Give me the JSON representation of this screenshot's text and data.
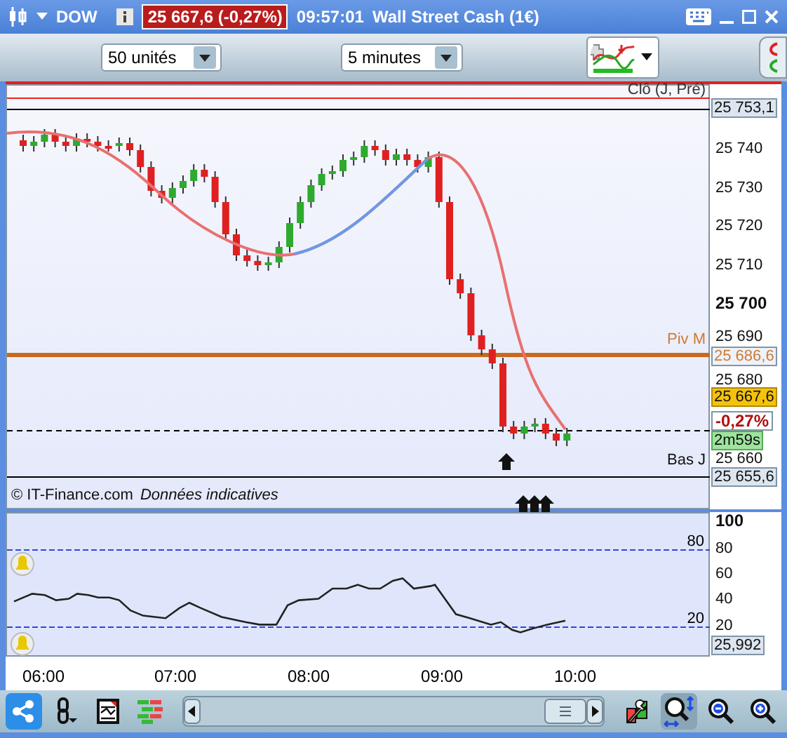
{
  "title_bar": {
    "symbol": "DOW",
    "quote": "25 667,6 (-0,27%)",
    "time": "09:57:01",
    "instrument": "Wall Street Cash (1€)"
  },
  "toolbar": {
    "units": "50 unités",
    "interval": "5 minutes"
  },
  "price_chart": {
    "line_labels": [
      {
        "text": "Clô (J, Pré)",
        "kind": "close"
      },
      {
        "text": "Piv M",
        "kind": "pivot"
      },
      {
        "text": "Bas J",
        "kind": "low"
      }
    ],
    "footer": {
      "copyright": "© IT-Finance.com",
      "note": "Données indicatives"
    },
    "axis_labels": [
      {
        "text": "25 753,1",
        "kind": "box"
      },
      {
        "text": "25 740",
        "kind": "tick"
      },
      {
        "text": "25 730",
        "kind": "tick"
      },
      {
        "text": "25 720",
        "kind": "tick"
      },
      {
        "text": "25 710",
        "kind": "tick"
      },
      {
        "text": "25 700",
        "kind": "major"
      },
      {
        "text": "25 690",
        "kind": "tick"
      },
      {
        "text": "25 686,6",
        "kind": "pivot"
      },
      {
        "text": "25 680",
        "kind": "tick"
      },
      {
        "text": "25 667,6",
        "kind": "last"
      },
      {
        "text": "-0,27%",
        "kind": "change"
      },
      {
        "text": "2m59s",
        "kind": "timer"
      },
      {
        "text": "25 660",
        "kind": "tick"
      },
      {
        "text": "25 655,6",
        "kind": "box"
      }
    ]
  },
  "indicator": {
    "level_labels": [
      "80",
      "20"
    ],
    "ticks": [
      "100",
      "80",
      "60",
      "40",
      "20"
    ],
    "value": "25,992"
  },
  "time_axis": [
    "06:00",
    "07:00",
    "08:00",
    "09:00",
    "10:00"
  ],
  "bottom_toolbar": {
    "tools": [
      {
        "kind": "share",
        "selected": true
      },
      {
        "kind": "link",
        "selected": false
      },
      {
        "kind": "report",
        "selected": false
      },
      {
        "kind": "bricks",
        "selected": false
      },
      {
        "kind": "wrench",
        "selected": false
      },
      {
        "kind": "zoom-fit",
        "selected": true
      },
      {
        "kind": "zoom-out",
        "selected": false
      },
      {
        "kind": "zoom-in",
        "selected": false
      }
    ]
  }
}
